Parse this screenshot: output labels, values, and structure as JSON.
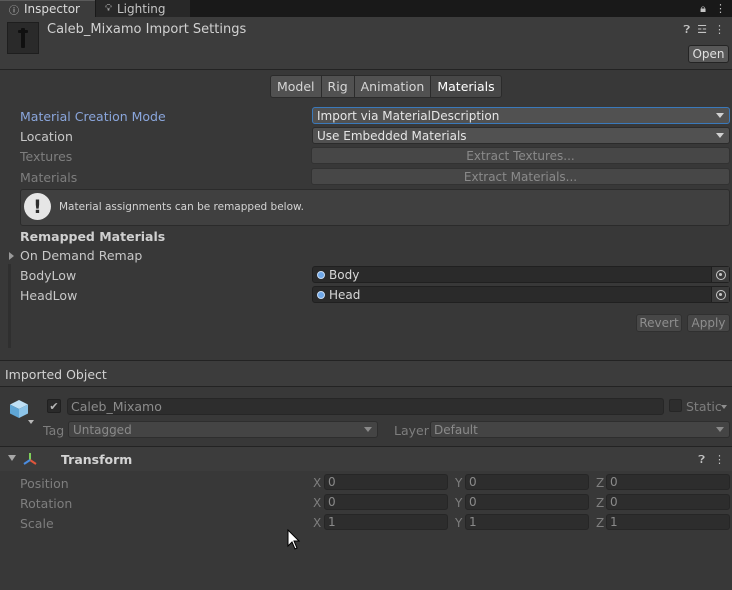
{
  "tabs": {
    "inspector": "Inspector",
    "lighting": "Lighting"
  },
  "header": {
    "title": "Caleb_Mixamo Import Settings",
    "open_label": "Open"
  },
  "subtabs": [
    "Model",
    "Rig",
    "Animation",
    "Materials"
  ],
  "active_subtab": "Materials",
  "materials": {
    "creation_mode_label": "Material Creation Mode",
    "creation_mode_value": "Import via MaterialDescription",
    "location_label": "Location",
    "location_value": "Use Embedded Materials",
    "textures_label": "Textures",
    "extract_textures_label": "Extract Textures...",
    "materials_label": "Materials",
    "extract_materials_label": "Extract Materials...",
    "info_text": "Material assignments can be remapped below.",
    "remapped_title": "Remapped Materials",
    "on_demand_label": "On Demand Remap",
    "remaps": [
      {
        "name": "BodyLow",
        "value": "Body"
      },
      {
        "name": "HeadLow",
        "value": "Head"
      }
    ],
    "revert_label": "Revert",
    "apply_label": "Apply"
  },
  "imported": {
    "title": "Imported Object",
    "object_name": "Caleb_Mixamo",
    "static_label": "Static",
    "tag_label": "Tag",
    "tag_value": "Untagged",
    "layer_label": "Layer",
    "layer_value": "Default"
  },
  "transform": {
    "title": "Transform",
    "rows": [
      {
        "label": "Position",
        "x": "0",
        "y": "0",
        "z": "0"
      },
      {
        "label": "Rotation",
        "x": "0",
        "y": "0",
        "z": "0"
      },
      {
        "label": "Scale",
        "x": "1",
        "y": "1",
        "z": "1"
      }
    ],
    "axis_x": "X",
    "axis_y": "Y",
    "axis_z": "Z"
  },
  "icons": {
    "inspector_tab": "info-icon",
    "lighting_tab": "lightbulb-icon",
    "lock": "lock-icon",
    "kebab": "kebab-menu-icon",
    "help": "help-icon",
    "presets": "presets-icon",
    "gameobject": "cube-icon",
    "transform": "transform-axes-icon",
    "object_picker": "object-picker-icon",
    "info_box": "exclamation-icon"
  }
}
